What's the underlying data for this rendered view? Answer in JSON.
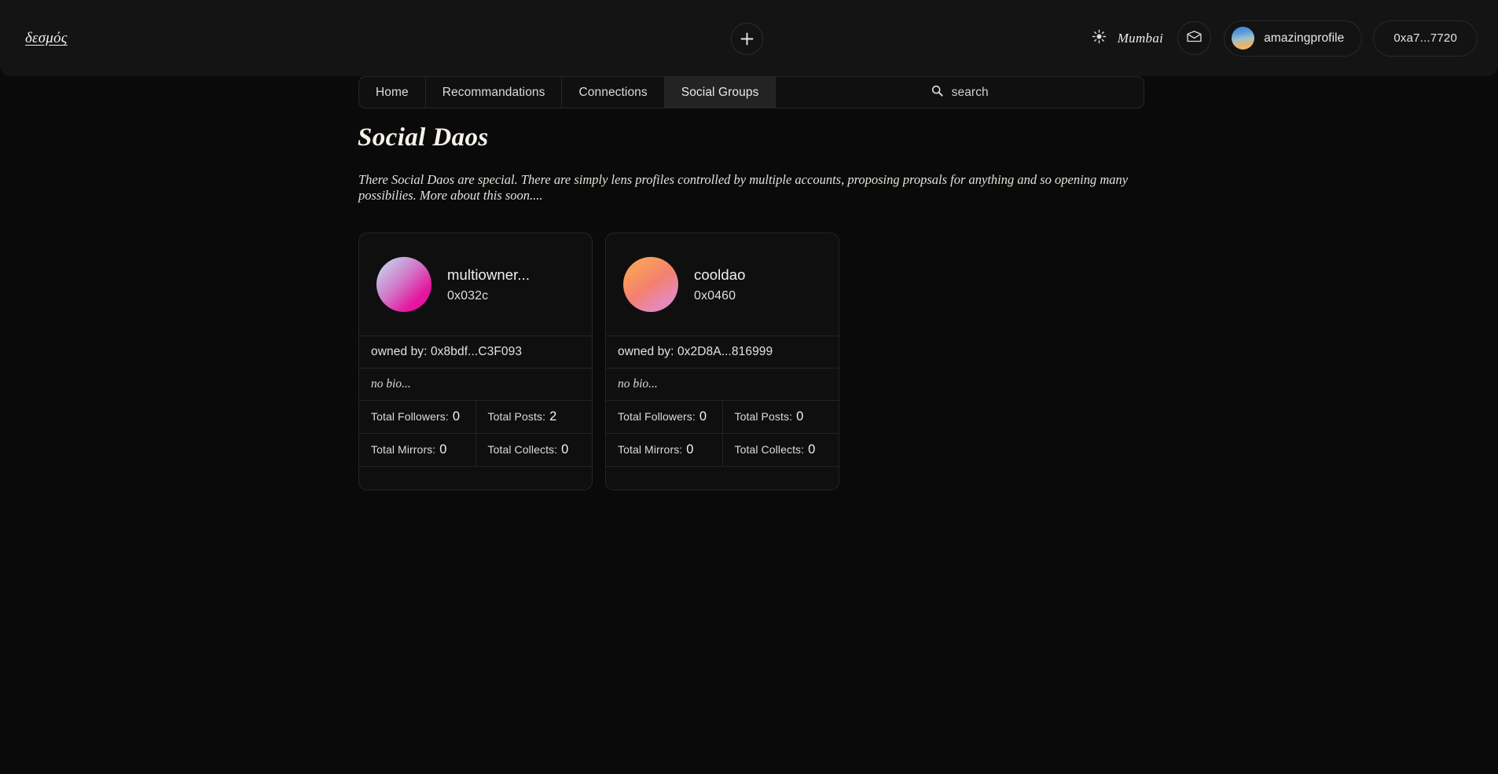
{
  "header": {
    "brand": "δεσμός",
    "add_icon": "plus-icon",
    "theme_icon": "sun-icon",
    "network": "Mumbai",
    "mail_icon": "envelope-icon",
    "profile_name": "amazingprofile",
    "wallet_address": "0xa7...7720",
    "avatar_gradient": [
      "#3f7fd6",
      "#f0bb6a"
    ]
  },
  "tabs": [
    {
      "label": "Home",
      "active": false
    },
    {
      "label": "Recommandations",
      "active": false
    },
    {
      "label": "Connections",
      "active": false
    },
    {
      "label": "Social Groups",
      "active": true
    }
  ],
  "search": {
    "icon": "search-icon",
    "placeholder": "search",
    "value": ""
  },
  "main": {
    "title": "Social Daos",
    "description": "There Social Daos are special. There are simply lens profiles controlled by multiple accounts, proposing propsals for anything and so opening many possibilies. More about this soon....",
    "labels": {
      "owned_by": "owned by:",
      "followers": "Total Followers:",
      "posts": "Total Posts:",
      "mirrors": "Total Mirrors:",
      "collects": "Total Collects:"
    },
    "cards": [
      {
        "handle": "multiowner...",
        "profile_id": "0x032c",
        "owned_by": "owned by: 0x8bdf...C3F093",
        "bio": "no bio...",
        "followers": "0",
        "posts": "2",
        "mirrors": "0",
        "collects": "0",
        "avatar_gradient": [
          "#cfc6e8",
          "#e5189f"
        ]
      },
      {
        "handle": "cooldao",
        "profile_id": "0x0460",
        "owned_by": "owned by: 0x2D8A...816999",
        "bio": "no bio...",
        "followers": "0",
        "posts": "0",
        "mirrors": "0",
        "collects": "0",
        "avatar_gradient": [
          "#f5a559",
          "#d98fc8"
        ]
      }
    ]
  },
  "colors": {
    "background": "#0a0a0a",
    "header_bg": "#141414",
    "card_bg": "#0f0f0f",
    "border": "#252525",
    "active_tab_bg": "#232323",
    "text": "#e9e9e9"
  }
}
